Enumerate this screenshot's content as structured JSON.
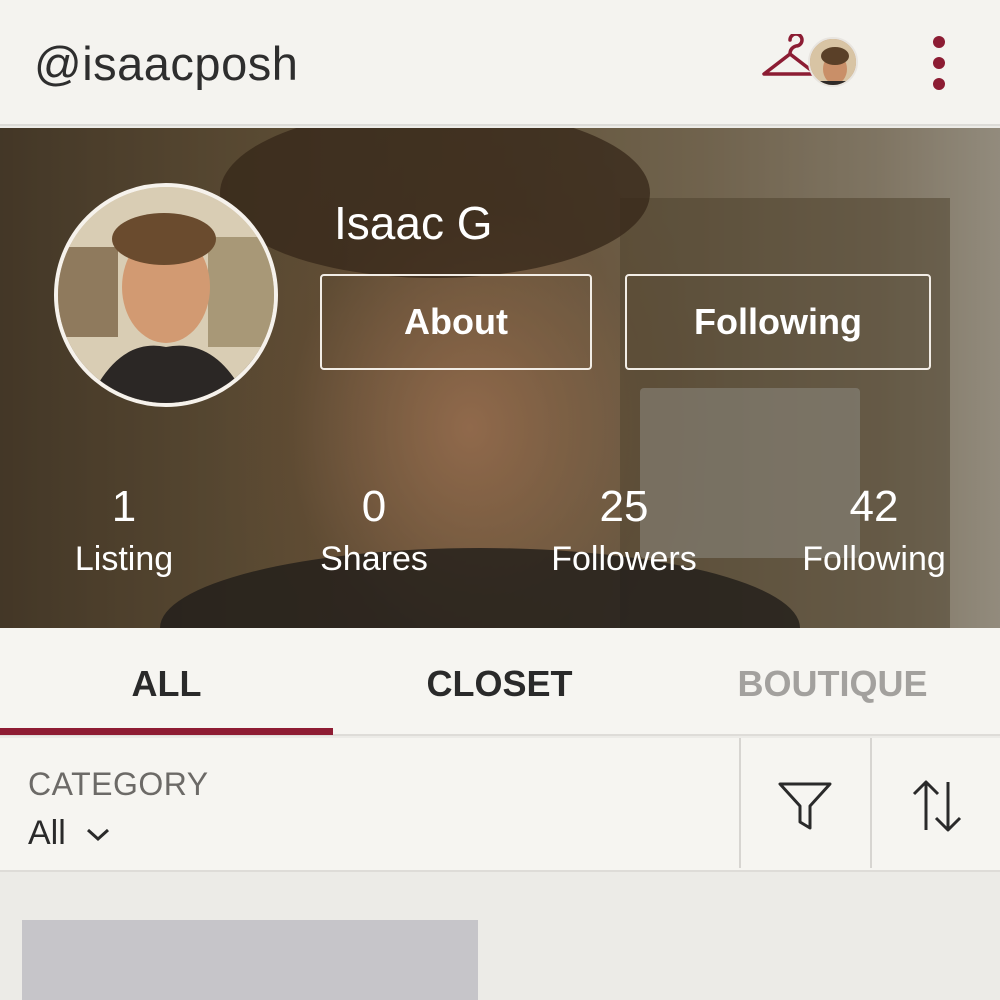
{
  "header": {
    "handle": "@isaacposh",
    "closet_icon": "hanger-icon",
    "menu_icon": "more-vertical-icon",
    "accent_color": "#8c1c33"
  },
  "profile": {
    "name": "Isaac G",
    "about_label": "About",
    "following_button_label": "Following"
  },
  "stats": [
    {
      "value": "1",
      "label": "Listing"
    },
    {
      "value": "0",
      "label": "Shares"
    },
    {
      "value": "25",
      "label": "Followers"
    },
    {
      "value": "42",
      "label": "Following"
    }
  ],
  "tabs": [
    {
      "label": "ALL",
      "active": true
    },
    {
      "label": "CLOSET",
      "active": false
    },
    {
      "label": "BOUTIQUE",
      "active": false
    }
  ],
  "filter": {
    "category_label": "CATEGORY",
    "category_value": "All",
    "filter_icon": "filter-funnel-icon",
    "sort_icon": "sort-arrows-icon"
  }
}
